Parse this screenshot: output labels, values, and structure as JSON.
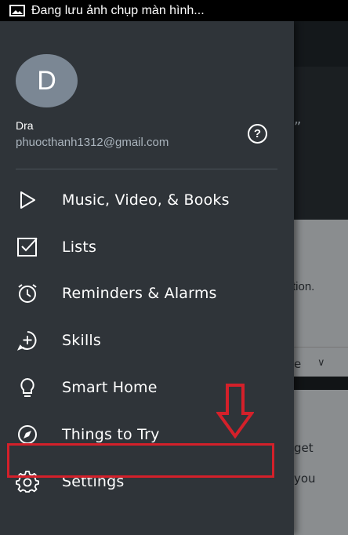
{
  "status_bar": {
    "icon": "image-icon",
    "text": "Đang lưu ảnh chụp màn hình..."
  },
  "drawer": {
    "avatar_letter": "D",
    "user_name": "Dra",
    "user_email": "phuocthanh1312@gmail.com",
    "help_icon": "?",
    "menu": [
      {
        "icon": "play-icon",
        "label": "Music, Video, & Books"
      },
      {
        "icon": "checklist-icon",
        "label": "Lists"
      },
      {
        "icon": "alarm-clock-icon",
        "label": "Reminders & Alarms"
      },
      {
        "icon": "skills-icon",
        "label": "Skills"
      },
      {
        "icon": "lightbulb-icon",
        "label": "Smart Home"
      },
      {
        "icon": "compass-icon",
        "label": "Things to Try"
      },
      {
        "icon": "gear-icon",
        "label": "Settings"
      }
    ]
  },
  "background": {
    "quote_mark": "”",
    "card_text": "tion.",
    "row_text": "e",
    "chevron": "∨",
    "text_1": "get",
    "text_2": "you"
  },
  "annotation": {
    "highlight_color": "#d4202a",
    "target": "Settings"
  },
  "colors": {
    "drawer_bg": "#2f3439",
    "avatar_bg": "#7b8794",
    "email_text": "#aab4bd"
  }
}
